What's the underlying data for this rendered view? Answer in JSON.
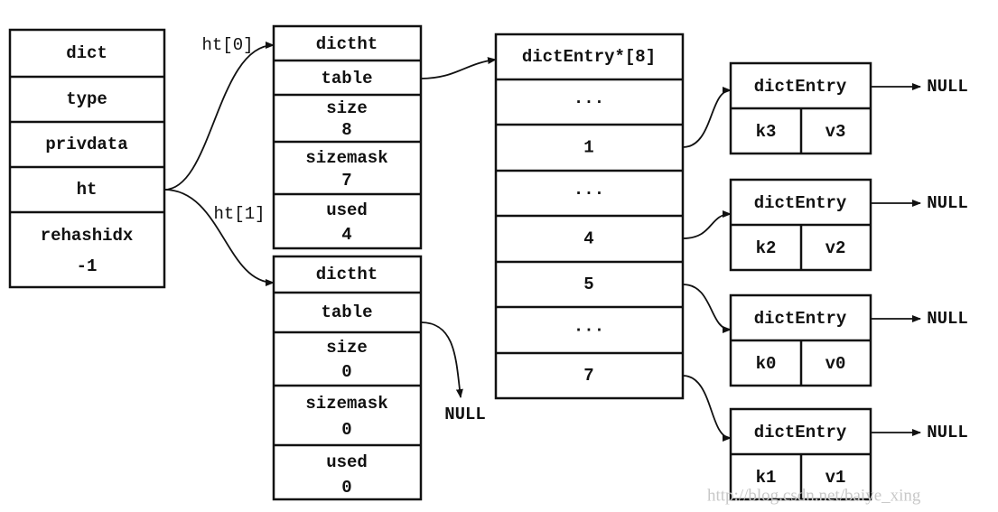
{
  "dict": {
    "cells": [
      "dict",
      "type",
      "privdata",
      "ht"
    ],
    "rehashidx_label": "rehashidx",
    "rehashidx_value": "-1"
  },
  "ht0": {
    "label": "ht[0]",
    "title": "dictht",
    "table": "table",
    "size_label": "size",
    "size": "8",
    "sizemask_label": "sizemask",
    "sizemask": "7",
    "used_label": "used",
    "used": "4"
  },
  "ht1": {
    "label": "ht[1]",
    "title": "dictht",
    "table": "table",
    "size_label": "size",
    "size": "0",
    "sizemask_label": "sizemask",
    "sizemask": "0",
    "used_label": "used",
    "used": "0",
    "table_target": "NULL"
  },
  "array": {
    "title": "dictEntry*[8]",
    "rows": [
      "...",
      "1",
      "...",
      "4",
      "5",
      "...",
      "7"
    ]
  },
  "entries": [
    {
      "title": "dictEntry",
      "key": "k3",
      "value": "v3",
      "next": "NULL"
    },
    {
      "title": "dictEntry",
      "key": "k2",
      "value": "v2",
      "next": "NULL"
    },
    {
      "title": "dictEntry",
      "key": "k0",
      "value": "v0",
      "next": "NULL"
    },
    {
      "title": "dictEntry",
      "key": "k1",
      "value": "v1",
      "next": "NULL"
    }
  ],
  "watermark": "http://blog.csdn.net/baiye_xing"
}
